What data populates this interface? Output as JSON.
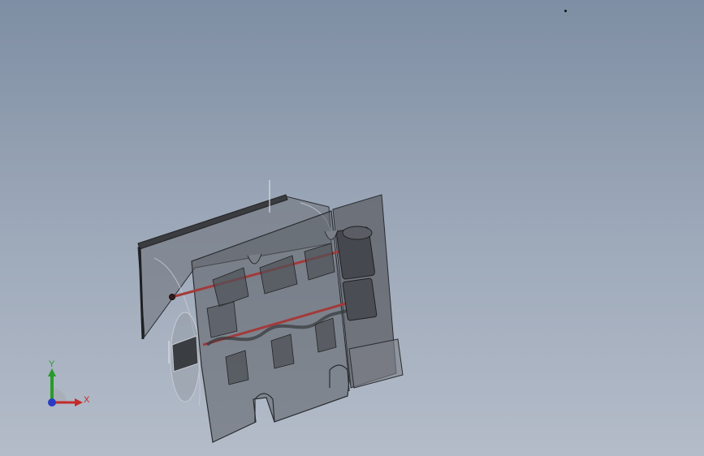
{
  "viewport": {
    "background_top": "#7e8ea3",
    "background_bottom": "#b4bcc9"
  },
  "triad": {
    "x_label": "X",
    "y_label": "Y",
    "x_color": "#c42a2a",
    "y_color": "#2a9a2a",
    "z_color": "#2a3cc4"
  },
  "model": {
    "body_color": "#5e6167",
    "edge_color": "#2a2c30",
    "shaft_color": "#a33a3a"
  }
}
